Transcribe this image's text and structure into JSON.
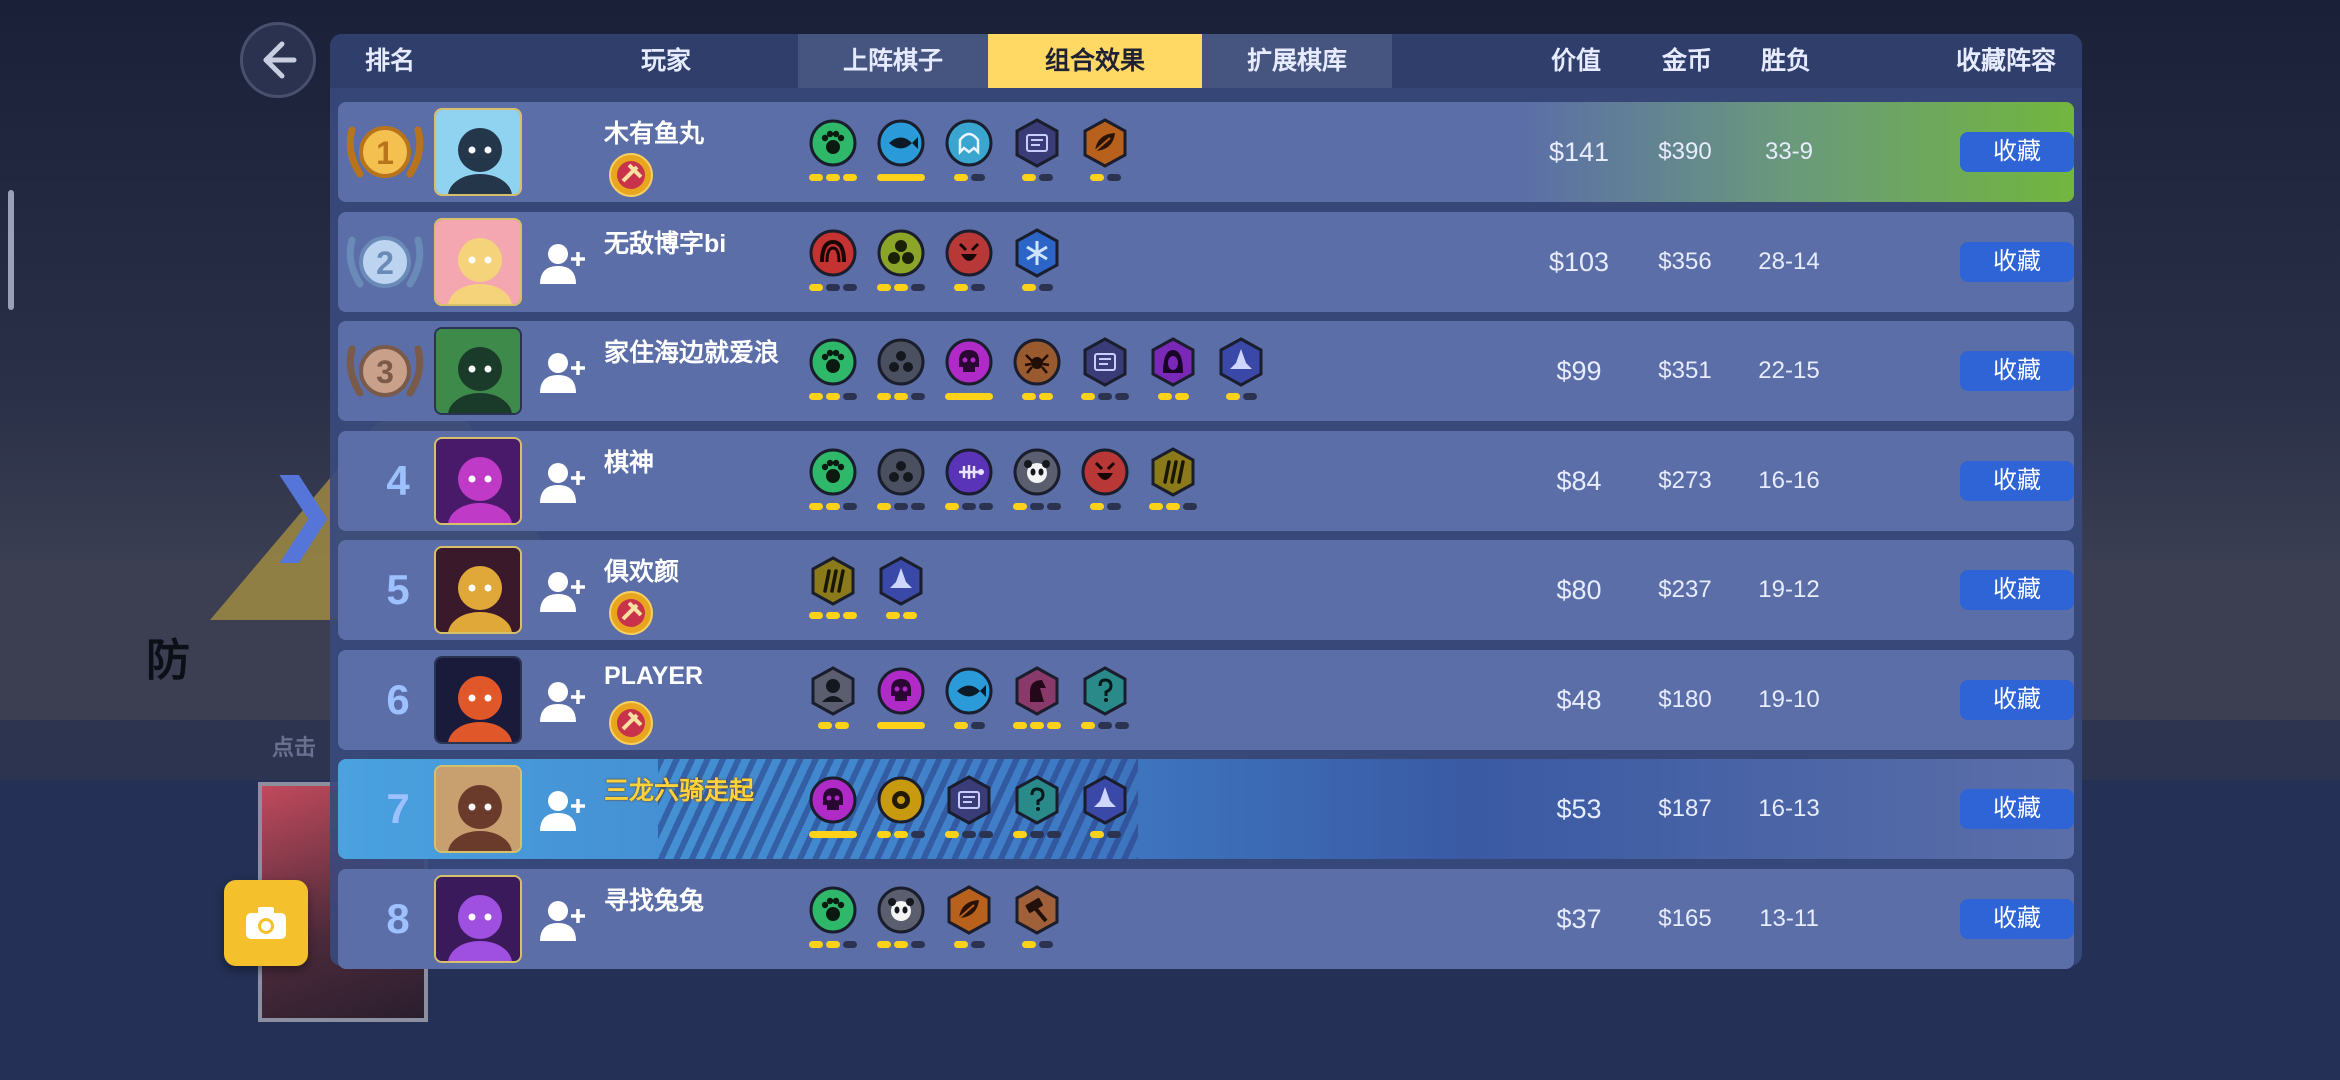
{
  "background": {
    "bg_text_1": "防",
    "bg_text_2": "点击"
  },
  "header": {
    "rank": "排名",
    "player": "玩家",
    "tabs": [
      "上阵棋子",
      "组合效果",
      "扩展棋库"
    ],
    "active_tab": "组合效果",
    "value": "价值",
    "gold": "金币",
    "win_loss": "胜负",
    "collect_lineup": "收藏阵容"
  },
  "fav_label": "收藏",
  "rows": [
    {
      "rank": "1",
      "name": "木有鱼丸",
      "value": "$141",
      "gold": "$390",
      "wl": "33-9",
      "has_badge": true,
      "synergies": [
        {
          "icon": "paw-icon",
          "color": "#2fb86a",
          "pips": [
            1,
            1,
            1
          ]
        },
        {
          "icon": "fish-icon",
          "color": "#2a9bd8",
          "pips": [
            2
          ]
        },
        {
          "icon": "ghost-icon",
          "color": "#3aa6d0",
          "pips": [
            1,
            0
          ]
        },
        {
          "icon": "tablet-icon",
          "color": "#3a3c78",
          "pips": [
            1,
            0
          ]
        },
        {
          "icon": "leaf-icon",
          "color": "#b8611c",
          "pips": [
            1,
            0
          ]
        }
      ]
    },
    {
      "rank": "2",
      "name": "无敌博字bi",
      "value": "$103",
      "gold": "$356",
      "wl": "28-14",
      "has_badge": false,
      "synergies": [
        {
          "icon": "arch-icon",
          "color": "#c43232",
          "pips": [
            1,
            0,
            0
          ]
        },
        {
          "icon": "crystal-icon",
          "color": "#8ba528",
          "pips": [
            1,
            1,
            0
          ]
        },
        {
          "icon": "demon-icon",
          "color": "#b83838",
          "pips": [
            1,
            0
          ]
        },
        {
          "icon": "ice-icon",
          "color": "#2d64c8",
          "pips": [
            1,
            0
          ]
        }
      ]
    },
    {
      "rank": "3",
      "name": "家住海边就爱浪",
      "value": "$99",
      "gold": "$351",
      "wl": "22-15",
      "has_badge": false,
      "synergies": [
        {
          "icon": "paw-icon",
          "color": "#2fb86a",
          "pips": [
            1,
            1,
            0
          ]
        },
        {
          "icon": "cell-icon",
          "color": "#4a5060",
          "pips": [
            1,
            1,
            0
          ]
        },
        {
          "icon": "skull-icon",
          "color": "#b02ac8",
          "pips": [
            2
          ]
        },
        {
          "icon": "spider-icon",
          "color": "#9a5a30",
          "pips": [
            1,
            1
          ]
        },
        {
          "icon": "tablet-icon",
          "color": "#3a3c78",
          "pips": [
            1,
            0,
            0
          ]
        },
        {
          "icon": "hood-icon",
          "color": "#7a28b8",
          "pips": [
            1,
            1
          ]
        },
        {
          "icon": "witch-hat-icon",
          "color": "#3a48a8",
          "pips": [
            1,
            0
          ]
        }
      ]
    },
    {
      "rank": "4",
      "name": "棋神",
      "value": "$84",
      "gold": "$273",
      "wl": "16-16",
      "has_badge": false,
      "synergies": [
        {
          "icon": "paw-icon",
          "color": "#2fb86a",
          "pips": [
            1,
            1,
            0
          ]
        },
        {
          "icon": "cell-icon",
          "color": "#4a5060",
          "pips": [
            1,
            0,
            0
          ]
        },
        {
          "icon": "fishbone-icon",
          "color": "#5a34b8",
          "pips": [
            1,
            0,
            0
          ]
        },
        {
          "icon": "panda-icon",
          "color": "#5a5e6e",
          "pips": [
            1,
            0,
            0
          ]
        },
        {
          "icon": "demon-icon",
          "color": "#b83838",
          "pips": [
            1,
            0
          ]
        },
        {
          "icon": "claw-icon",
          "color": "#8a7a1a",
          "pips": [
            1,
            1,
            0
          ]
        }
      ]
    },
    {
      "rank": "5",
      "name": "俱欢颜",
      "value": "$80",
      "gold": "$237",
      "wl": "19-12",
      "has_badge": true,
      "synergies": [
        {
          "icon": "claw-icon",
          "color": "#8a7a1a",
          "pips": [
            1,
            1,
            1
          ]
        },
        {
          "icon": "witch-hat-icon",
          "color": "#3a48a8",
          "pips": [
            1,
            1
          ]
        }
      ]
    },
    {
      "rank": "6",
      "name": "PLAYER",
      "value": "$48",
      "gold": "$180",
      "wl": "19-10",
      "has_badge": true,
      "synergies": [
        {
          "icon": "knight-icon",
          "color": "#5a5e6e",
          "pips": [
            1,
            1
          ]
        },
        {
          "icon": "skull-icon",
          "color": "#b02ac8",
          "pips": [
            2
          ]
        },
        {
          "icon": "fish-icon",
          "color": "#2a9bd8",
          "pips": [
            1,
            0
          ]
        },
        {
          "icon": "horse-icon",
          "color": "#8a3a6a",
          "pips": [
            1,
            1,
            1
          ]
        },
        {
          "icon": "mystery-icon",
          "color": "#2a8a8a",
          "pips": [
            1,
            0,
            0
          ]
        }
      ]
    },
    {
      "rank": "7",
      "name": "三龙六骑走起",
      "value": "$53",
      "gold": "$187",
      "wl": "16-13",
      "has_badge": false,
      "synergies": [
        {
          "icon": "skull-icon",
          "color": "#b02ac8",
          "pips": [
            2
          ]
        },
        {
          "icon": "gold-icon",
          "color": "#c89a10",
          "pips": [
            1,
            1,
            0
          ]
        },
        {
          "icon": "tablet-icon",
          "color": "#3a3c78",
          "pips": [
            1,
            0,
            0
          ]
        },
        {
          "icon": "mystery-icon",
          "color": "#2a8a8a",
          "pips": [
            1,
            0,
            0
          ]
        },
        {
          "icon": "witch-hat-icon",
          "color": "#3a48a8",
          "pips": [
            1,
            0
          ]
        }
      ]
    },
    {
      "rank": "8",
      "name": "寻找兔兔",
      "value": "$37",
      "gold": "$165",
      "wl": "13-11",
      "has_badge": false,
      "synergies": [
        {
          "icon": "paw-icon",
          "color": "#2fb86a",
          "pips": [
            1,
            1,
            0
          ]
        },
        {
          "icon": "panda-icon",
          "color": "#5a5e6e",
          "pips": [
            1,
            1,
            0
          ]
        },
        {
          "icon": "leaf-icon",
          "color": "#b8611c",
          "pips": [
            1,
            0
          ]
        },
        {
          "icon": "hammer-icon",
          "color": "#a0603a",
          "pips": [
            1,
            0
          ]
        }
      ]
    }
  ]
}
